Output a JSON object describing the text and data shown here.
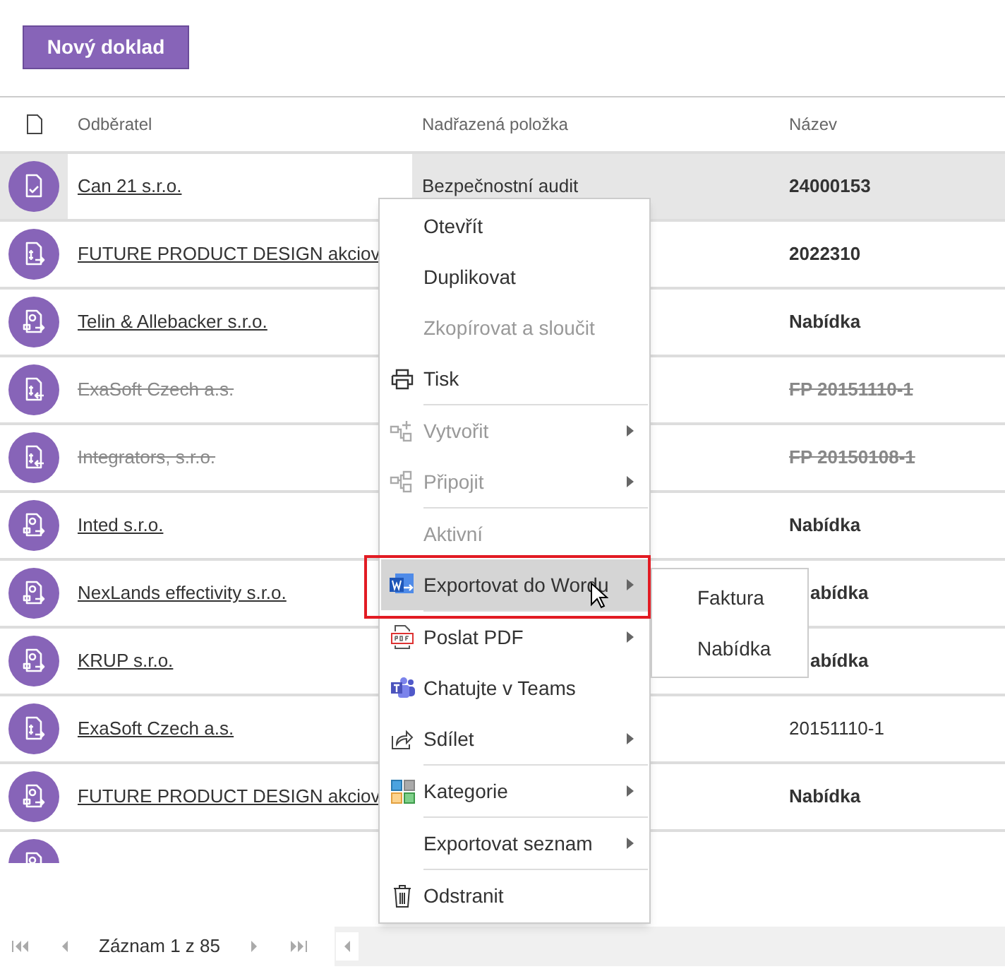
{
  "toolbar": {
    "new_button": "Nový doklad"
  },
  "table": {
    "columns": [
      "Odběratel",
      "Nadřazená položka",
      "Název"
    ],
    "rows": [
      {
        "kind": "check",
        "customer": "Can 21 s.r.o.",
        "parent": "Bezpečnostní audit",
        "name": "24000153",
        "selected": true,
        "deleted": false,
        "bold": true
      },
      {
        "kind": "payout",
        "customer": "FUTURE PRODUCT DESIGN akciov",
        "name": "2022310",
        "selected": false,
        "deleted": false,
        "bold": true
      },
      {
        "kind": "offer",
        "customer": "Telin & Allebacker s.r.o.",
        "name": "Nabídka",
        "selected": false,
        "deleted": false,
        "bold": true
      },
      {
        "kind": "payin",
        "customer": "ExaSoft Czech a.s.",
        "name": "FP 20151110-1",
        "selected": false,
        "deleted": true,
        "bold": true
      },
      {
        "kind": "payin",
        "customer": "Integrators, s.r.o.",
        "name": "FP 20150108-1",
        "selected": false,
        "deleted": true,
        "bold": true
      },
      {
        "kind": "offer",
        "customer": "Inted s.r.o.",
        "name": "Nabídka",
        "selected": false,
        "deleted": false,
        "bold": true
      },
      {
        "kind": "offer",
        "customer": "NexLands effectivity s.r.o.",
        "name": "abídka",
        "selected": false,
        "deleted": false,
        "bold": true
      },
      {
        "kind": "offer",
        "customer": "KRUP s.r.o.",
        "name": "abídka",
        "selected": false,
        "deleted": false,
        "bold": true
      },
      {
        "kind": "payout",
        "customer": "ExaSoft Czech a.s.",
        "name": "20151110-1",
        "selected": false,
        "deleted": false,
        "bold": false
      },
      {
        "kind": "offer",
        "customer": "FUTURE PRODUCT DESIGN akciov",
        "name": "Nabídka",
        "selected": false,
        "deleted": false,
        "bold": true
      },
      {
        "kind": "offer",
        "selected": false
      }
    ]
  },
  "context_menu": {
    "items": [
      {
        "kind": "item",
        "label": "Otevřít",
        "disabled": false,
        "submenu": false,
        "selected": false
      },
      {
        "kind": "item",
        "label": "Duplikovat",
        "disabled": false,
        "submenu": false,
        "selected": false
      },
      {
        "kind": "item",
        "label": "Zkopírovat a sloučit",
        "disabled": true,
        "submenu": false,
        "selected": false
      },
      {
        "kind": "print",
        "label": "Tisk",
        "disabled": false,
        "submenu": false,
        "selected": false
      },
      {
        "kind": "separator"
      },
      {
        "kind": "create",
        "label": "Vytvořit",
        "disabled": true,
        "submenu": true,
        "selected": false
      },
      {
        "kind": "connect",
        "label": "Připojit",
        "disabled": true,
        "submenu": true,
        "selected": false
      },
      {
        "kind": "separator"
      },
      {
        "kind": "item",
        "label": "Aktivní",
        "disabled": true,
        "submenu": false,
        "selected": false
      },
      {
        "kind": "word",
        "label": "Exportovat do Wordu",
        "disabled": false,
        "submenu": true,
        "selected": true
      },
      {
        "kind": "separator"
      },
      {
        "kind": "pdf",
        "label": "Poslat PDF",
        "disabled": false,
        "submenu": true,
        "selected": false
      },
      {
        "kind": "teams",
        "label": "Chatujte v Teams",
        "disabled": false,
        "submenu": false,
        "selected": false
      },
      {
        "kind": "share",
        "label": "Sdílet",
        "disabled": false,
        "submenu": true,
        "selected": false
      },
      {
        "kind": "separator"
      },
      {
        "kind": "categories",
        "label": "Kategorie",
        "disabled": false,
        "submenu": true,
        "selected": false
      },
      {
        "kind": "separator"
      },
      {
        "kind": "item",
        "label": "Exportovat seznam",
        "disabled": false,
        "submenu": true,
        "selected": false
      },
      {
        "kind": "separator"
      },
      {
        "kind": "trash",
        "label": "Odstranit",
        "disabled": false,
        "submenu": false,
        "selected": false
      }
    ]
  },
  "submenu": {
    "items": [
      "Faktura",
      "Nabídka"
    ]
  },
  "pager": {
    "text": "Záznam 1 z 85"
  }
}
